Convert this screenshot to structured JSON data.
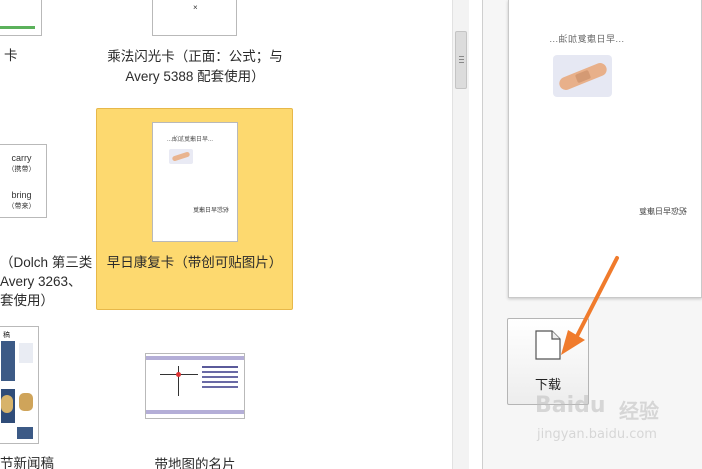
{
  "gallery": {
    "tiles": [
      {
        "caption": "乘法闪光卡（正面：公式；与 Avery 5388 配套使用）",
        "card_symbol": "×"
      },
      {
        "caption": "早日康复卡（带创可贴图片）",
        "mini_heading": "...早日康复加油...",
        "mini_footer": "祝您早日康复"
      },
      {
        "caption": "带地图的名片"
      }
    ],
    "left_column": {
      "caption_top": "卡",
      "word_card": {
        "word1": "carry",
        "word1_cn": "（携带）",
        "word2": "bring",
        "word2_cn": "（带来）"
      },
      "caption_middle_lines": [
        "（Dolch 第三类",
        "Avery 3263、",
        "套使用）"
      ],
      "newsletter_header": "稿",
      "caption_bottom": "节新闻稿"
    }
  },
  "preview": {
    "heading": "...早日康复加油...",
    "footer": "祝您早日康复"
  },
  "download_button": {
    "label": "下载"
  },
  "watermark": {
    "brand": "Baidu",
    "cn": "经验",
    "url": "jingyan.baidu.com"
  },
  "colors": {
    "selected_tile": "#fdd96f",
    "arrow": "#f07b2c"
  }
}
